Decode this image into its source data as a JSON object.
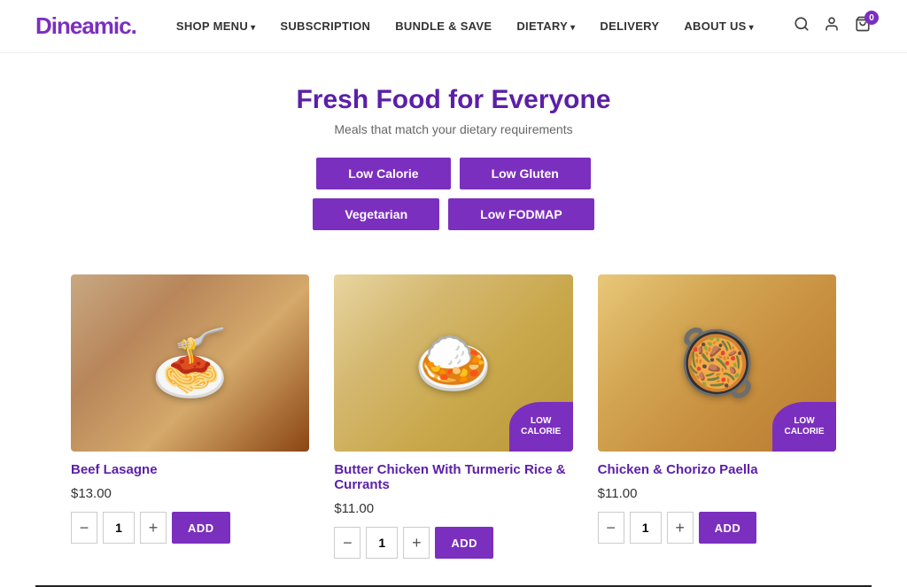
{
  "brand": {
    "name": "Dineamic",
    "dot": "."
  },
  "nav": {
    "links": [
      {
        "label": "SHOP MENU",
        "hasDropdown": true
      },
      {
        "label": "SUBSCRIPTION",
        "hasDropdown": false
      },
      {
        "label": "BUNDLE & SAVE",
        "hasDropdown": false
      },
      {
        "label": "DIETARY",
        "hasDropdown": true
      },
      {
        "label": "DELIVERY",
        "hasDropdown": false
      },
      {
        "label": "ABOUT US",
        "hasDropdown": true
      }
    ],
    "cart_count": "0"
  },
  "hero": {
    "title": "Fresh Food for Everyone",
    "subtitle": "Meals that match your dietary requirements",
    "filters": [
      {
        "label": "Low Calorie"
      },
      {
        "label": "Low Gluten"
      },
      {
        "label": "Vegetarian"
      },
      {
        "label": "Low FODMAP"
      }
    ]
  },
  "products": [
    {
      "id": "beef-lasagne",
      "name": "Beef Lasagne",
      "price": "$13.00",
      "qty": "1",
      "badge": null,
      "food_class": "food-lasagne"
    },
    {
      "id": "butter-chicken",
      "name": "Butter Chicken With Turmeric Rice & Currants",
      "price": "$11.00",
      "qty": "1",
      "badge": "LOW CALORIE",
      "food_class": "food-chicken"
    },
    {
      "id": "chorizo-paella",
      "name": "Chicken & Chorizo Paella",
      "price": "$11.00",
      "qty": "1",
      "badge": "LOW CALORIE",
      "food_class": "food-paella"
    }
  ],
  "buttons": {
    "add_label": "ADD",
    "qty_minus": "−",
    "qty_plus": "+"
  }
}
